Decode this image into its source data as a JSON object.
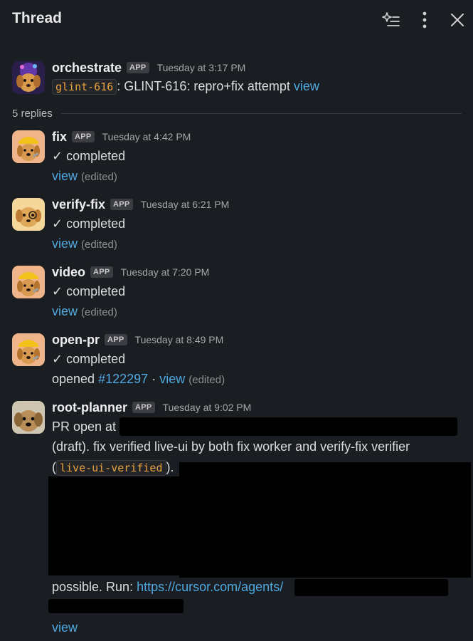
{
  "header": {
    "title": "Thread"
  },
  "parent": {
    "name": "orchestrate",
    "badge": "APP",
    "timestamp": "Tuesday at 3:17 PM",
    "tag": "glint-616",
    "text": ": GLINT-616: repro+fix attempt",
    "link": "view"
  },
  "replies_label": "5 replies",
  "messages": [
    {
      "name": "fix",
      "badge": "APP",
      "timestamp": "Tuesday at 4:42 PM",
      "status": "✓ completed",
      "link": "view",
      "edited": "(edited)"
    },
    {
      "name": "verify-fix",
      "badge": "APP",
      "timestamp": "Tuesday at 6:21 PM",
      "status": "✓ completed",
      "link": "view",
      "edited": "(edited)"
    },
    {
      "name": "video",
      "badge": "APP",
      "timestamp": "Tuesday at 7:20 PM",
      "status": "✓ completed",
      "link": "view",
      "edited": "(edited)"
    },
    {
      "name": "open-pr",
      "badge": "APP",
      "timestamp": "Tuesday at 8:49 PM",
      "status": "✓ completed",
      "opened_prefix": "opened",
      "pr_link": "#122297",
      "separator": "·",
      "link": "view",
      "edited": "(edited)"
    }
  ],
  "root": {
    "name": "root-planner",
    "badge": "APP",
    "timestamp": "Tuesday at 9:02 PM",
    "line1": "PR open at",
    "line2": "(draft). fix verified live-ui by both fix worker and verify-fix verifier",
    "line3_open": "(",
    "tag": "live-ui-verified",
    "line3_close": ").",
    "line4": "possible. Run:",
    "run_link": "https://cursor.com/agents/",
    "link": "view"
  },
  "colors": {
    "background": "#1a1d21",
    "link": "#4fa8e0",
    "code": "#e8a23c",
    "badge_bg": "#3b3d42"
  }
}
